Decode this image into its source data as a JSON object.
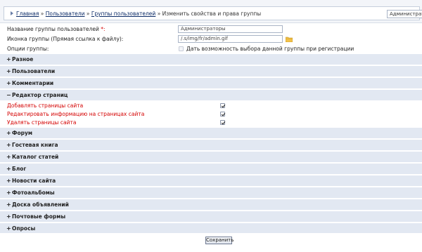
{
  "breadcrumb": {
    "items": [
      "Главная",
      "Пользователи",
      "Группы пользователей"
    ],
    "current": "Изменить свойства и права группы",
    "separator": "»"
  },
  "user_select": {
    "value": "Администраторы"
  },
  "form": {
    "name_label": "Название группы пользователей",
    "name_required_mark": "*:",
    "name_value": "Администраторы",
    "icon_label": "Иконка группы (Прямая ссылка к файлу):",
    "icon_value": "/.s/img/fr/admin.gif",
    "options_label": "Опции группы:",
    "option_checkbox_label": "Дать возможность выбора данной группы при регистрации"
  },
  "sections": [
    {
      "sign": "+",
      "title": "Разное"
    },
    {
      "sign": "+",
      "title": "Пользователи"
    },
    {
      "sign": "+",
      "title": "Комментарии"
    },
    {
      "sign": "−",
      "title": "Редактор страниц"
    },
    {
      "sign": "+",
      "title": "Форум"
    },
    {
      "sign": "+",
      "title": "Гостевая книга"
    },
    {
      "sign": "+",
      "title": "Каталог статей"
    },
    {
      "sign": "+",
      "title": "Блог"
    },
    {
      "sign": "+",
      "title": "Новости сайта"
    },
    {
      "sign": "+",
      "title": "Фотоальбомы"
    },
    {
      "sign": "+",
      "title": "Доска объявлений"
    },
    {
      "sign": "+",
      "title": "Почтовые формы"
    },
    {
      "sign": "+",
      "title": "Опросы"
    }
  ],
  "page_editor_permissions": [
    {
      "label": "Добавлять страницы сайта",
      "checked": true
    },
    {
      "label": "Редактировать информацию на страницах сайта",
      "checked": true
    },
    {
      "label": "Удалять страницы сайта",
      "checked": true
    }
  ],
  "save_button": "Сохранить",
  "colors": {
    "section_bg": "#e2e8f2",
    "permission_text": "#d40000",
    "link": "#0a2a66"
  }
}
